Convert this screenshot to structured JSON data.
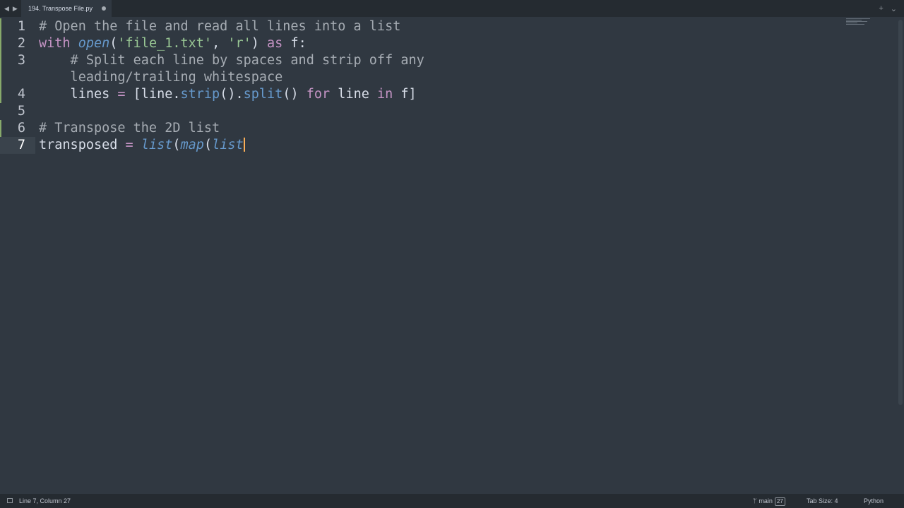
{
  "tab": {
    "title": "194. Transpose File.py"
  },
  "editor": {
    "current_line": "7",
    "lines": [
      {
        "num": "1",
        "tokens": [
          {
            "t": "# Open the file and read all lines into a list",
            "c": "c"
          }
        ]
      },
      {
        "num": "2",
        "tokens": [
          {
            "t": "with ",
            "c": "k"
          },
          {
            "t": "open",
            "c": "f"
          },
          {
            "t": "(",
            "c": "d"
          },
          {
            "t": "'file_1.txt'",
            "c": "s"
          },
          {
            "t": ", ",
            "c": "d"
          },
          {
            "t": "'r'",
            "c": "s"
          },
          {
            "t": ") ",
            "c": "d"
          },
          {
            "t": "as",
            "c": "k"
          },
          {
            "t": " f:",
            "c": "d"
          }
        ]
      },
      {
        "num": "3",
        "tokens": [
          {
            "t": "    # Split each line by spaces and strip off any",
            "c": "c"
          }
        ]
      },
      {
        "num": "",
        "tokens": [
          {
            "t": "    leading/trailing whitespace",
            "c": "c"
          }
        ]
      },
      {
        "num": "4",
        "tokens": [
          {
            "t": "    lines ",
            "c": "d"
          },
          {
            "t": "=",
            "c": "k"
          },
          {
            "t": " [line.",
            "c": "d"
          },
          {
            "t": "strip",
            "c": "m"
          },
          {
            "t": "().",
            "c": "d"
          },
          {
            "t": "split",
            "c": "m"
          },
          {
            "t": "() ",
            "c": "d"
          },
          {
            "t": "for",
            "c": "k"
          },
          {
            "t": " line ",
            "c": "d"
          },
          {
            "t": "in",
            "c": "k"
          },
          {
            "t": " f]",
            "c": "d"
          }
        ]
      },
      {
        "num": "5",
        "tokens": []
      },
      {
        "num": "6",
        "tokens": [
          {
            "t": "# Transpose the 2D list",
            "c": "c"
          }
        ]
      },
      {
        "num": "7",
        "tokens": [
          {
            "t": "transposed ",
            "c": "d"
          },
          {
            "t": "=",
            "c": "k"
          },
          {
            "t": " ",
            "c": "d"
          },
          {
            "t": "list",
            "c": "f"
          },
          {
            "t": "(",
            "c": "d"
          },
          {
            "t": "map",
            "c": "f"
          },
          {
            "t": "(",
            "c": "d"
          },
          {
            "t": "list",
            "c": "f"
          }
        ]
      }
    ]
  },
  "status": {
    "position": "Line 7, Column 27",
    "branch": "main",
    "branch_count": "27",
    "tab_size": "Tab Size: 4",
    "syntax": "Python"
  },
  "colors": {
    "background": "#303841",
    "comment": "#a6acb3",
    "keyword": "#c594c5",
    "string": "#99c794",
    "function": "#6699cc",
    "cursor": "#f9ae58",
    "modified_gutter": "#87a96b"
  },
  "icons": {
    "nav_back": "triangle-left",
    "nav_forward": "triangle-right",
    "new_tab": "plus",
    "tab_list": "chevron-down",
    "branch": "git-branch",
    "panel": "square"
  }
}
